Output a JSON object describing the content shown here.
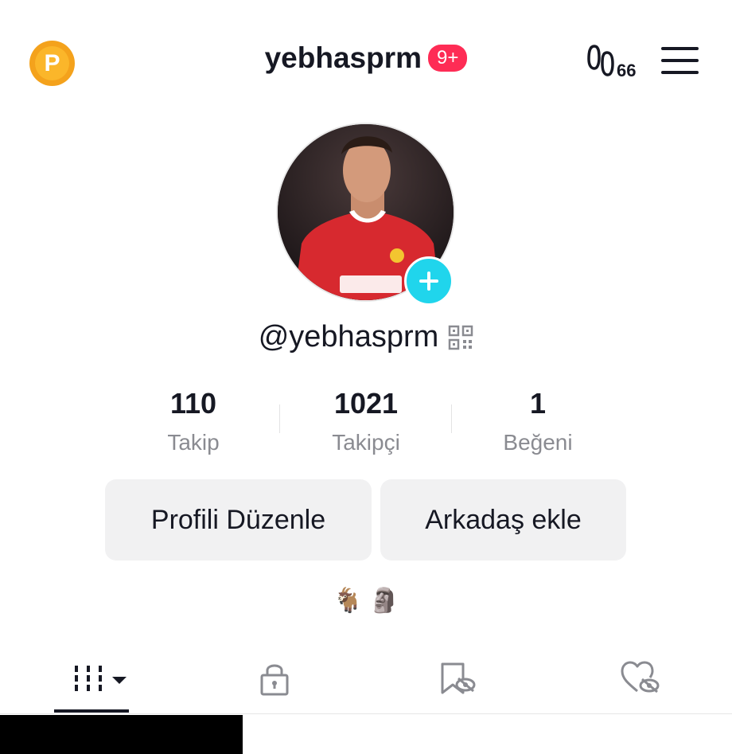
{
  "header": {
    "coin_label": "P",
    "username": "yebhasprm",
    "notification_badge": "9+",
    "footprint_count": "66"
  },
  "profile": {
    "handle": "@yebhasprm",
    "avatar_description_icon": "profile-photo"
  },
  "stats": [
    {
      "value": "110",
      "label": "Takip"
    },
    {
      "value": "1021",
      "label": "Takipçi"
    },
    {
      "value": "1",
      "label": "Beğeni"
    }
  ],
  "actions": {
    "edit_profile": "Profili Düzenle",
    "add_friends": "Arkadaş ekle"
  },
  "bio": "🐐 🗿",
  "tabs": [
    {
      "icon": "grid-icon",
      "active": true
    },
    {
      "icon": "lock-icon",
      "active": false
    },
    {
      "icon": "saved-hidden-icon",
      "active": false
    },
    {
      "icon": "liked-hidden-icon",
      "active": false
    }
  ],
  "colors": {
    "accent": "#fe2c55",
    "add_button": "#20d5ec",
    "coin": "#f4a21c",
    "button_bg": "#f1f1f2",
    "secondary_text": "#8a8b91"
  }
}
